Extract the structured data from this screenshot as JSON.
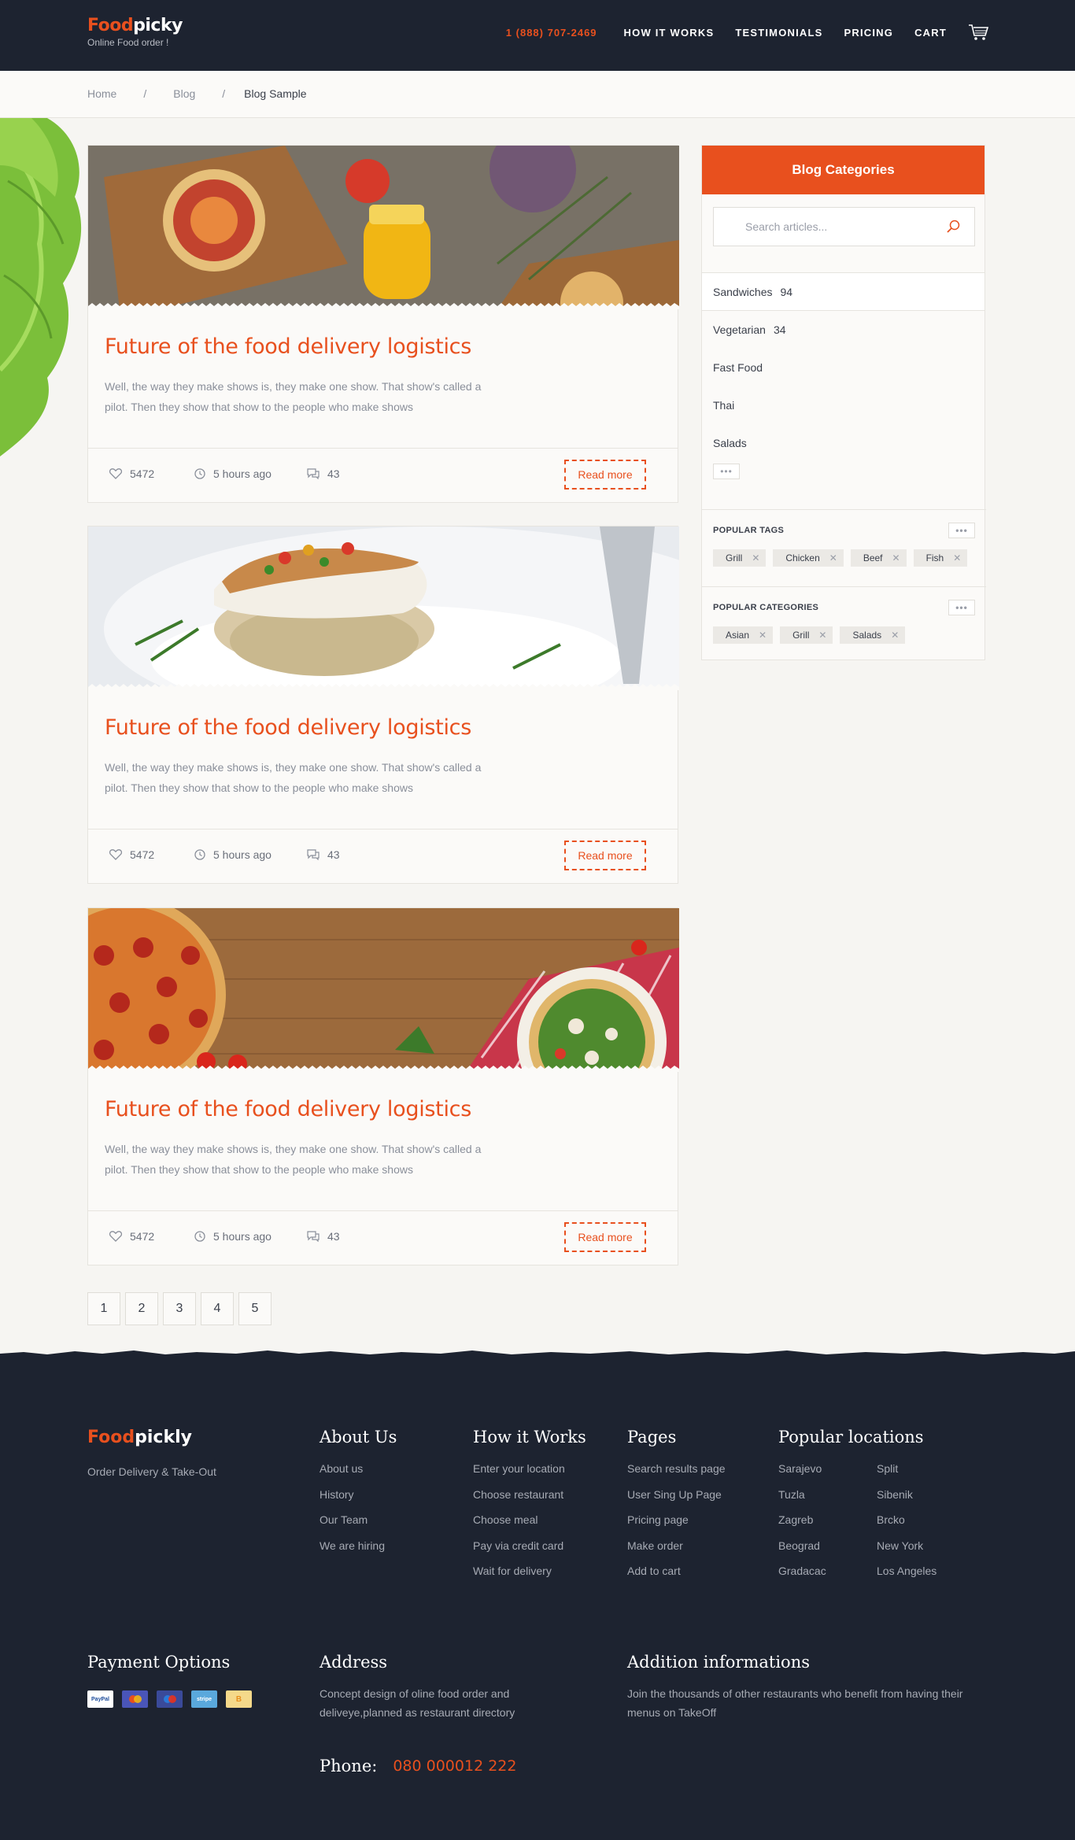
{
  "header": {
    "logo_food": "Food",
    "logo_picky": "picky",
    "tagline": "Online Food order !",
    "phone": "1 (888) 707-2469",
    "nav": [
      "HOW IT WORKS",
      "TESTIMONIALS",
      "PRICING",
      "CART"
    ]
  },
  "breadcrumb": [
    "Home",
    "/",
    "Blog",
    "/",
    "Blog Sample"
  ],
  "posts": [
    {
      "title": "Future of the food delivery logistics",
      "text": "Well, the way they make shows is, they make one show. That show's called a pilot. Then they show that show to the people who make shows",
      "likes": "5472",
      "time": "5 hours ago",
      "comments": "43",
      "read_more": "Read more"
    },
    {
      "title": "Future of the food delivery logistics",
      "text": "Well, the way they make shows is, they make one show. That show's called a pilot. Then they show that show to the people who make shows",
      "likes": "5472",
      "time": "5 hours ago",
      "comments": "43",
      "read_more": "Read more"
    },
    {
      "title": "Future of the food delivery logistics",
      "text": "Well, the way they make shows is, they make one show. That show's called a pilot. Then they show that show to the people who make shows",
      "likes": "5472",
      "time": "5 hours ago",
      "comments": "43",
      "read_more": "Read more"
    }
  ],
  "pagination": [
    "1",
    "2",
    "3",
    "4",
    "5"
  ],
  "sidebar": {
    "title": "Blog Categories",
    "search_placeholder": "Search articles...",
    "categories": [
      {
        "name": "Sandwiches",
        "count": "94"
      },
      {
        "name": "Vegetarian",
        "count": "34"
      },
      {
        "name": "Fast Food",
        "count": ""
      },
      {
        "name": "Thai",
        "count": ""
      },
      {
        "name": "Salads",
        "count": ""
      }
    ],
    "more": "•••",
    "popular_tags_title": "POPULAR TAGS",
    "popular_tags": [
      "Grill",
      "Chicken",
      "Beef",
      "Fish"
    ],
    "popular_categories_title": "POPULAR CATEGORIES",
    "popular_categories": [
      "Asian",
      "Grill",
      "Salads"
    ]
  },
  "footer": {
    "logo_food": "Food",
    "logo_picky": "pickly",
    "tagline": "Order Delivery & Take-Out",
    "about": {
      "title": "About Us",
      "links": [
        "About us",
        "History",
        "Our Team",
        "We are hiring"
      ]
    },
    "how": {
      "title": "How it Works",
      "links": [
        "Enter your location",
        "Choose restaurant",
        "Choose meal",
        "Pay via credit card",
        "Wait for delivery"
      ]
    },
    "pages": {
      "title": "Pages",
      "links": [
        "Search results page",
        "User Sing Up Page",
        "Pricing page",
        "Make order",
        "Add to cart"
      ]
    },
    "locations": {
      "title": "Popular locations",
      "links": [
        "Sarajevo",
        "Split",
        "Tuzla",
        "Sibenik",
        "Zagreb",
        "Brcko",
        "Beograd",
        "New York",
        "Gradacac",
        "Los Angeles"
      ]
    },
    "payment_title": "Payment Options",
    "payment_icons": [
      "PayPal",
      "",
      "",
      "stripe",
      "B"
    ],
    "address_title": "Address",
    "address_text": "Concept design of oline food order and deliveye,planned as restaurant directory",
    "additional_title": "Addition informations",
    "additional_text": "Join the thousands of other restaurants who benefit from having their menus on TakeOff",
    "phone_label": "Phone:",
    "phone_number": "080 000012 222"
  },
  "colors": {
    "accent": "#e8501e",
    "dark": "#1d2330",
    "paper": "#f6f5f2"
  }
}
